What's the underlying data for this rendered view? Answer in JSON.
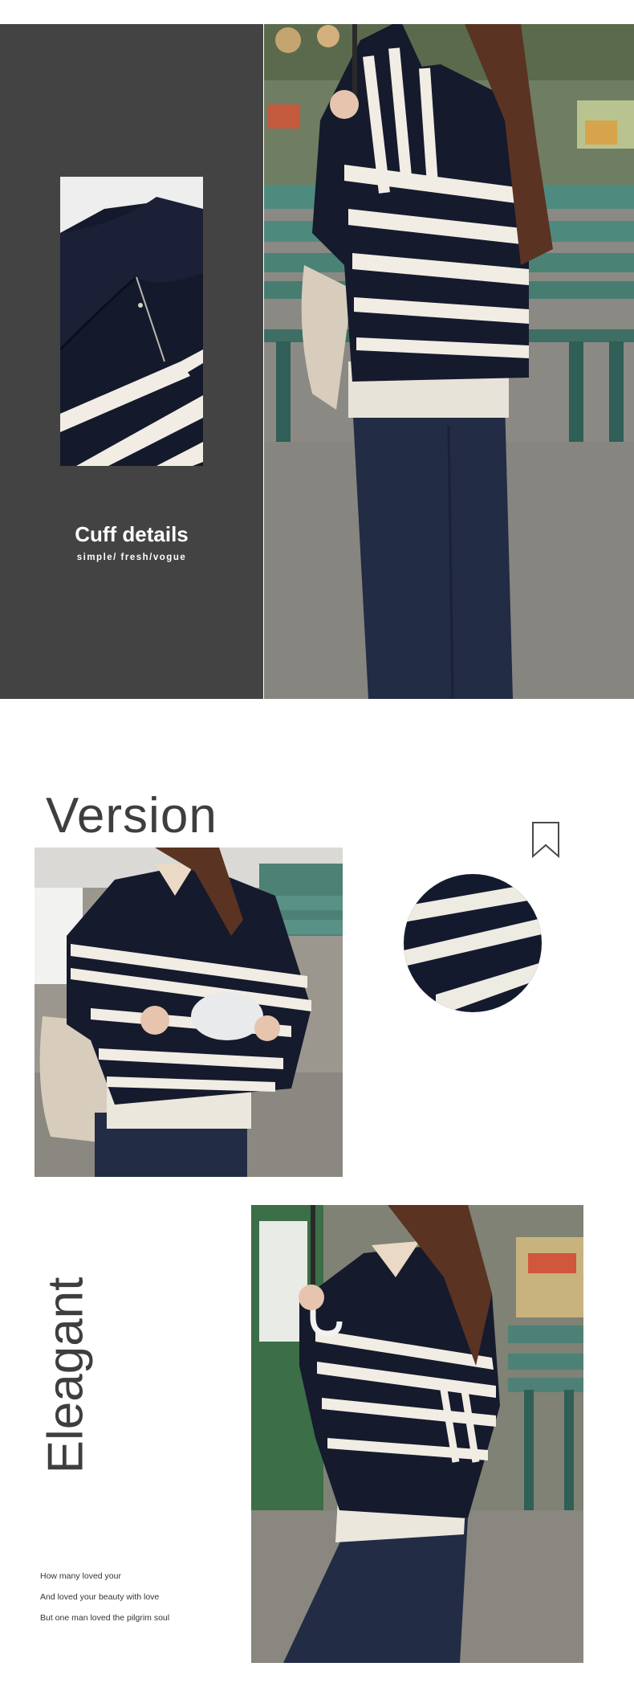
{
  "cuff": {
    "title": "Cuff details",
    "subtitle": "simple/ fresh/vogue"
  },
  "version": {
    "title": "Version"
  },
  "elegant": {
    "title": "Eleagant",
    "poem": [
      "How many loved your",
      "And loved your beauty with love",
      "But one man loved the pilgrim soul"
    ]
  },
  "colors": {
    "panel_grey": "#434343",
    "navy": "#15192c",
    "stripe": "#f1ede4",
    "text": "#3e3e3e"
  },
  "icons": {
    "bookmark": "bookmark-icon"
  }
}
